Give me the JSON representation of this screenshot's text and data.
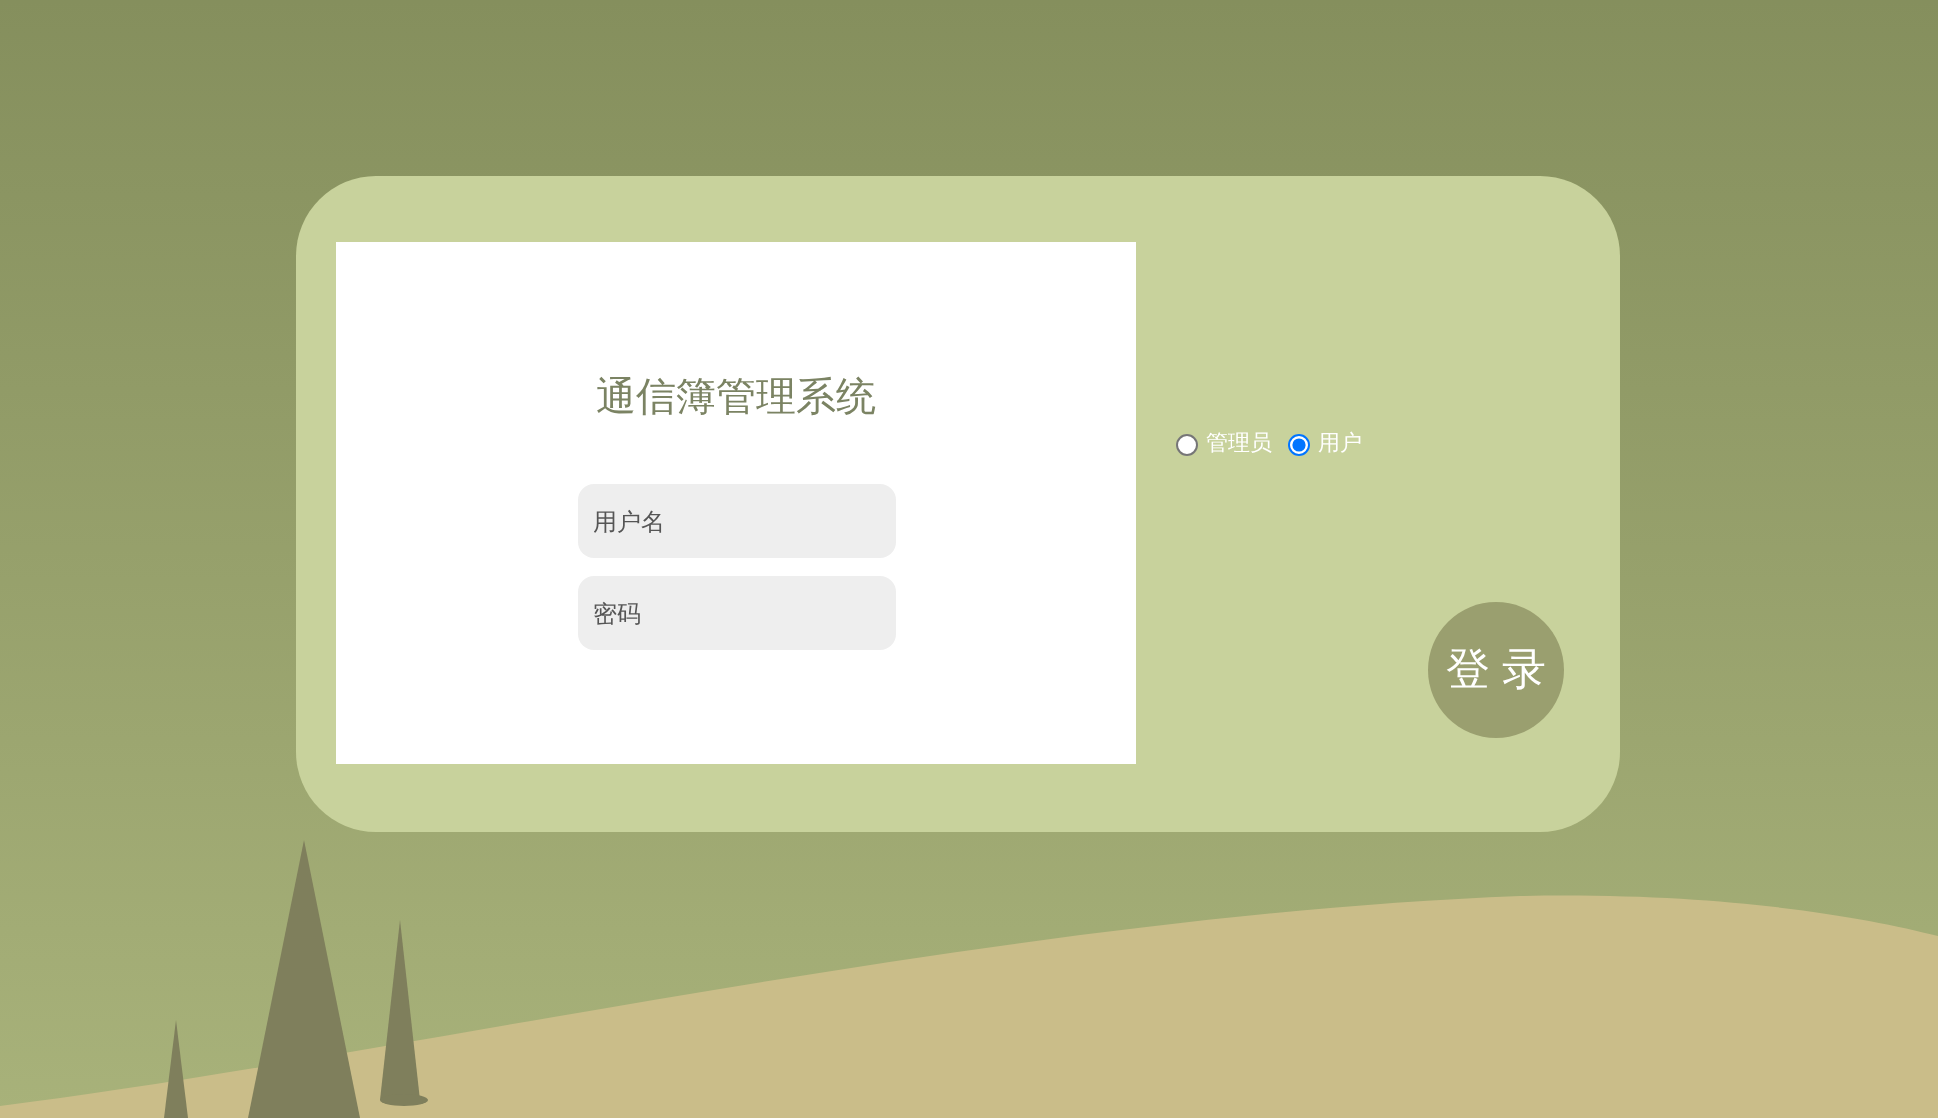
{
  "title": "通信簿管理系统",
  "fields": [
    {
      "placeholder": "用户名"
    },
    {
      "placeholder": "密码"
    }
  ],
  "roles": [
    {
      "label": "管理员",
      "selected": false
    },
    {
      "label": "用户",
      "selected": true
    }
  ],
  "login_button": "登 录"
}
